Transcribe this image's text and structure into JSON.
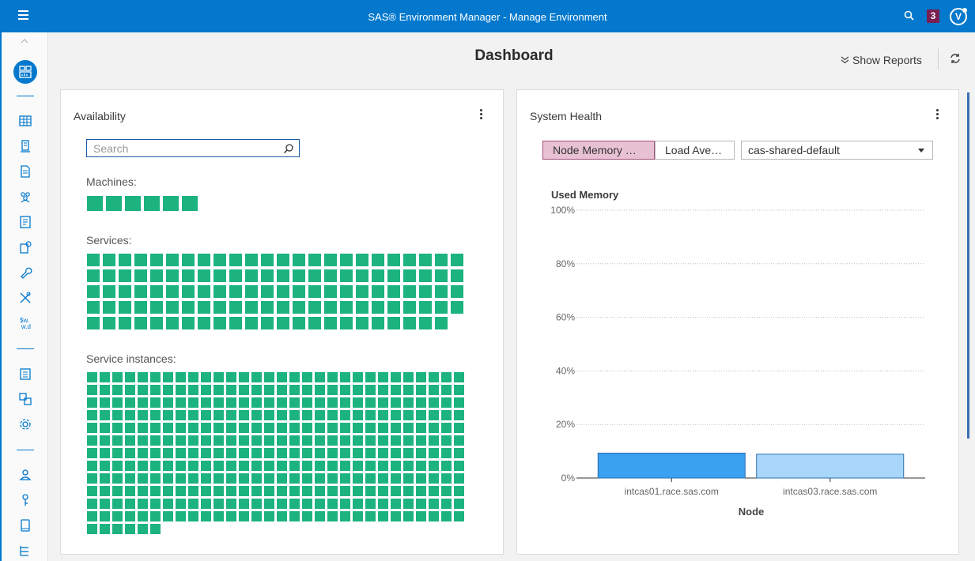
{
  "app": {
    "title": "SAS® Environment Manager - Manage Environment",
    "notification_count": "3",
    "user_initial": "V"
  },
  "header": {
    "page_title": "Dashboard",
    "show_reports_label": "Show Reports"
  },
  "availability": {
    "title": "Availability",
    "search_placeholder": "Search",
    "machines_label": "Machines:",
    "services_label": "Services:",
    "instances_label": "Service instances:",
    "machines_count": 6,
    "services_count": 119,
    "instances_count": 366,
    "status_color": "#1cb37f"
  },
  "system_health": {
    "title": "System Health",
    "tab_node_memory": "Node Memory …",
    "tab_load_average": "Load Ave…",
    "server_select_value": "cas-shared-default",
    "chart_data": {
      "type": "bar",
      "title": "Used Memory",
      "xlabel": "Node",
      "ylabel": "",
      "categories": [
        "intcas01.race.sas.com",
        "intcas03.race.sas.com"
      ],
      "values": [
        9.3,
        8.9
      ],
      "ylim": [
        0,
        100
      ],
      "y_ticks": [
        "0%",
        "20%",
        "40%",
        "60%",
        "80%",
        "100%"
      ],
      "grid": true,
      "bar_colors": [
        "#3aa0f0",
        "#a9d6fb"
      ]
    }
  },
  "colors": {
    "brand": "#0378cd",
    "active_tab": "#e8c1d3",
    "badge": "#7a1f4f"
  }
}
